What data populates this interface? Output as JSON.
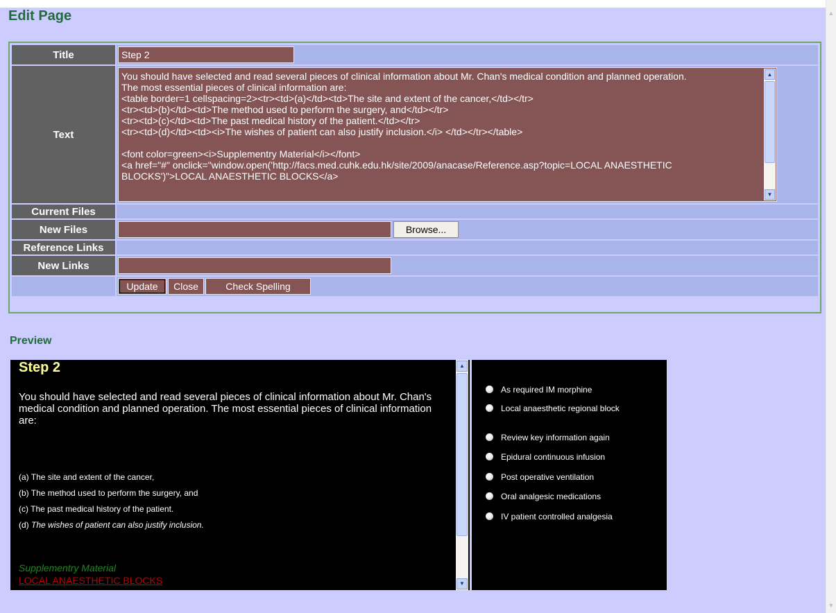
{
  "page": {
    "title": "Edit Page",
    "preview_heading": "Preview"
  },
  "form": {
    "labels": {
      "title": "Title",
      "text": "Text",
      "current_files": "Current Files",
      "new_files": "New Files",
      "reference_links": "Reference Links",
      "new_links": "New Links"
    },
    "title_value": "Step 2",
    "text_value": "You should have selected and read several pieces of clinical information about Mr. Chan's medical condition and planned operation.\nThe most essential pieces of clinical information are:\n<table border=1 cellspacing=2><tr><td>(a)</td><td>The site and extent of the cancer,</td></tr>\n<tr><td>(b)</td><td>The method used to perform the surgery, and</td></tr>\n<tr><td>(c)</td><td>The past medical history of the patient.</td></tr>\n<tr><td>(d)</td><td><i>The wishes of patient can also justify inclusion.</i> </td></tr></table>\n\n<font color=green><i>Supplementry Material</i></font>\n<a href=\"#\" onclick=\"window.open('http://facs.med.cuhk.edu.hk/site/2009/anacase/Reference.asp?topic=LOCAL ANAESTHETIC BLOCKS')\">LOCAL ANAESTHETIC BLOCKS</a>",
    "new_links_value": "",
    "buttons": {
      "browse": "Browse...",
      "update": "Update",
      "close": "Close",
      "check_spelling": "Check Spelling"
    }
  },
  "preview": {
    "title": "Step 2",
    "intro": "You should have selected and read several pieces of clinical information about Mr. Chan's medical condition and planned operation. The most essential pieces of clinical information are:",
    "items": [
      {
        "letter": "(a)",
        "text": "The site and extent of the cancer,",
        "italic": false
      },
      {
        "letter": "(b)",
        "text": "The method used to perform the surgery, and",
        "italic": false
      },
      {
        "letter": "(c)",
        "text": "The past medical history of the patient.",
        "italic": false
      },
      {
        "letter": "(d)",
        "text": "The wishes of patient can also justify inclusion.",
        "italic": true
      }
    ],
    "supplementary": "Supplementry Material",
    "link": "LOCAL ANAESTHETIC BLOCKS"
  },
  "options": [
    "As required IM morphine",
    "Local anaesthetic regional block",
    "Review key information again",
    "Epidural continuous infusion",
    "Post operative ventilation",
    "Oral analgesic medications",
    "IV patient controlled analgesia"
  ],
  "colors": {
    "page_bg": "#ccccff",
    "label_bg": "#616161",
    "field_bg": "#855454",
    "heading_green": "#1f6b3a",
    "preview_title": "#ffff99",
    "link_red": "#c00000"
  }
}
